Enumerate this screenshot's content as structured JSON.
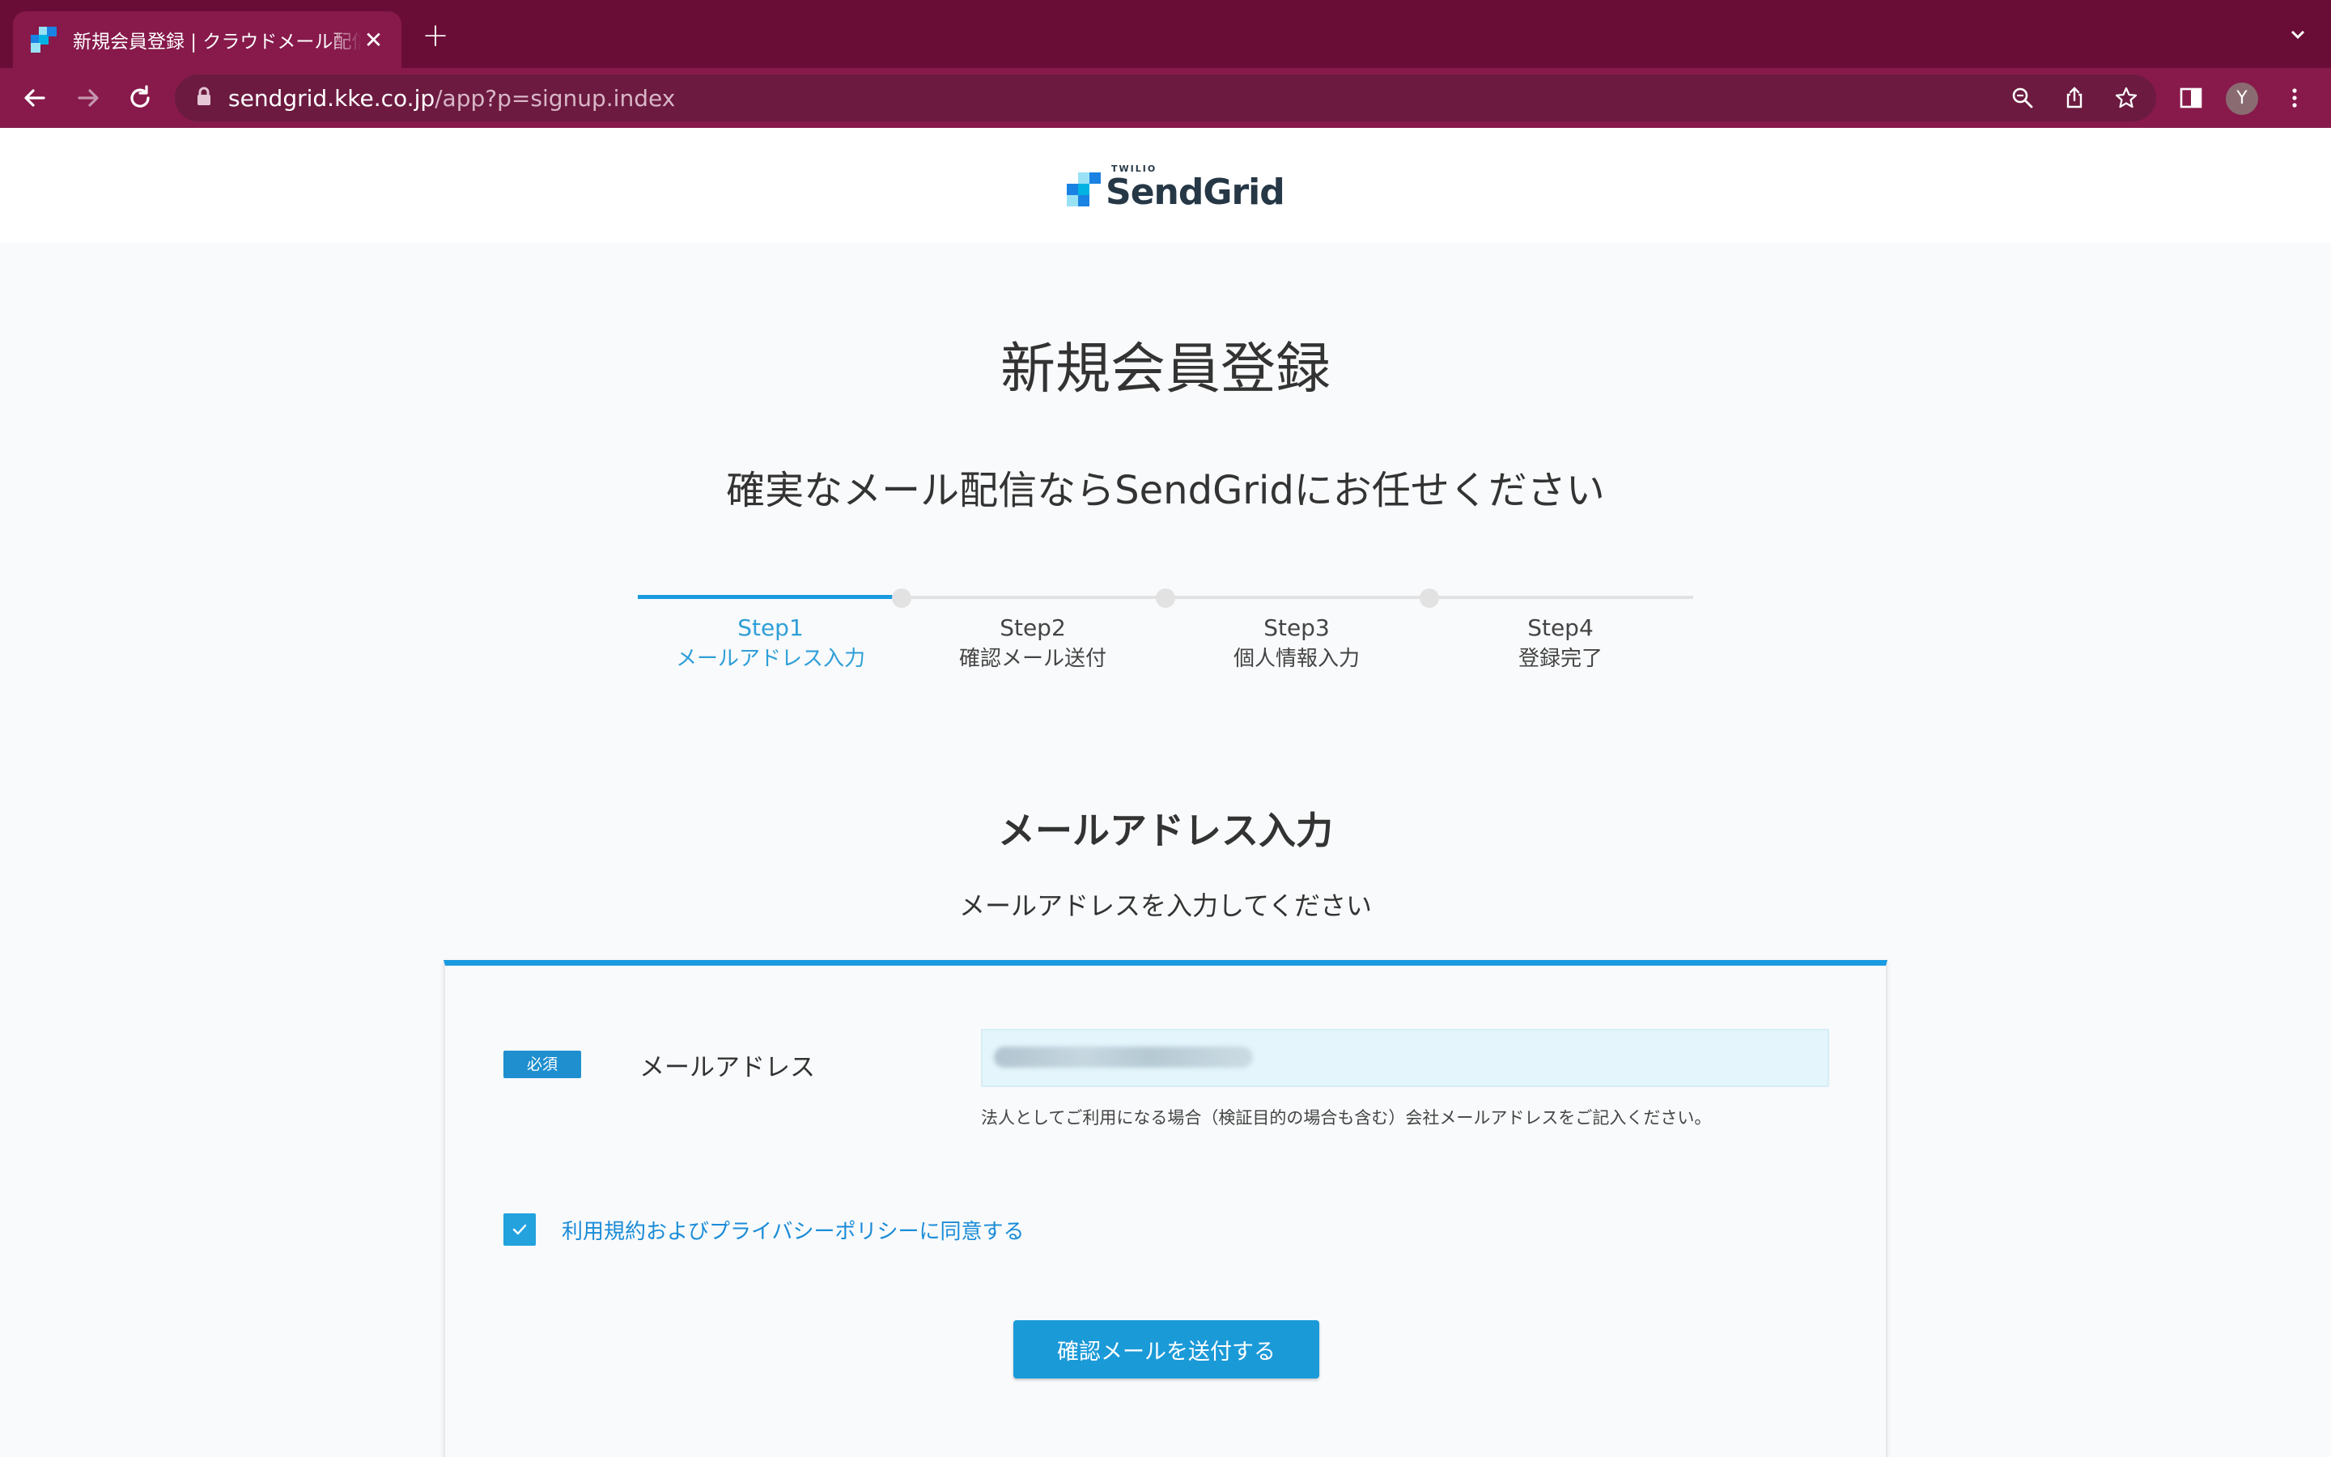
{
  "browser": {
    "tab_title": "新規会員登録 | クラウドメール配信",
    "new_tab_label": "+",
    "url_host": "sendgrid.kke.co.jp",
    "url_path": "/app?p=signup.index",
    "profile_initial": "Y"
  },
  "header": {
    "logo_small": "TWILIO",
    "logo_word": "SendGrid"
  },
  "page": {
    "title": "新規会員登録",
    "subtitle": "確実なメール配信ならSendGridにお任せください"
  },
  "stepper": {
    "active_index": 0,
    "steps": [
      {
        "num": "Step1",
        "name": "メールアドレス入力"
      },
      {
        "num": "Step2",
        "name": "確認メール送付"
      },
      {
        "num": "Step3",
        "name": "個人情報入力"
      },
      {
        "num": "Step4",
        "name": "登録完了"
      }
    ]
  },
  "section": {
    "title": "メールアドレス入力",
    "description": "メールアドレスを入力してください"
  },
  "form": {
    "required_badge": "必須",
    "email_label": "メールアドレス",
    "email_value": "",
    "email_note": "法人としてご利用になる場合（検証目的の場合も含む）会社メールアドレスをご記入ください。",
    "agree_checked": true,
    "agree_label": "利用規約およびプライバシーポリシーに同意する",
    "submit_label": "確認メールを送付する"
  },
  "colors": {
    "tabbar": "#690d37",
    "toolbar": "#871a4b",
    "accent": "#1a9be0"
  }
}
